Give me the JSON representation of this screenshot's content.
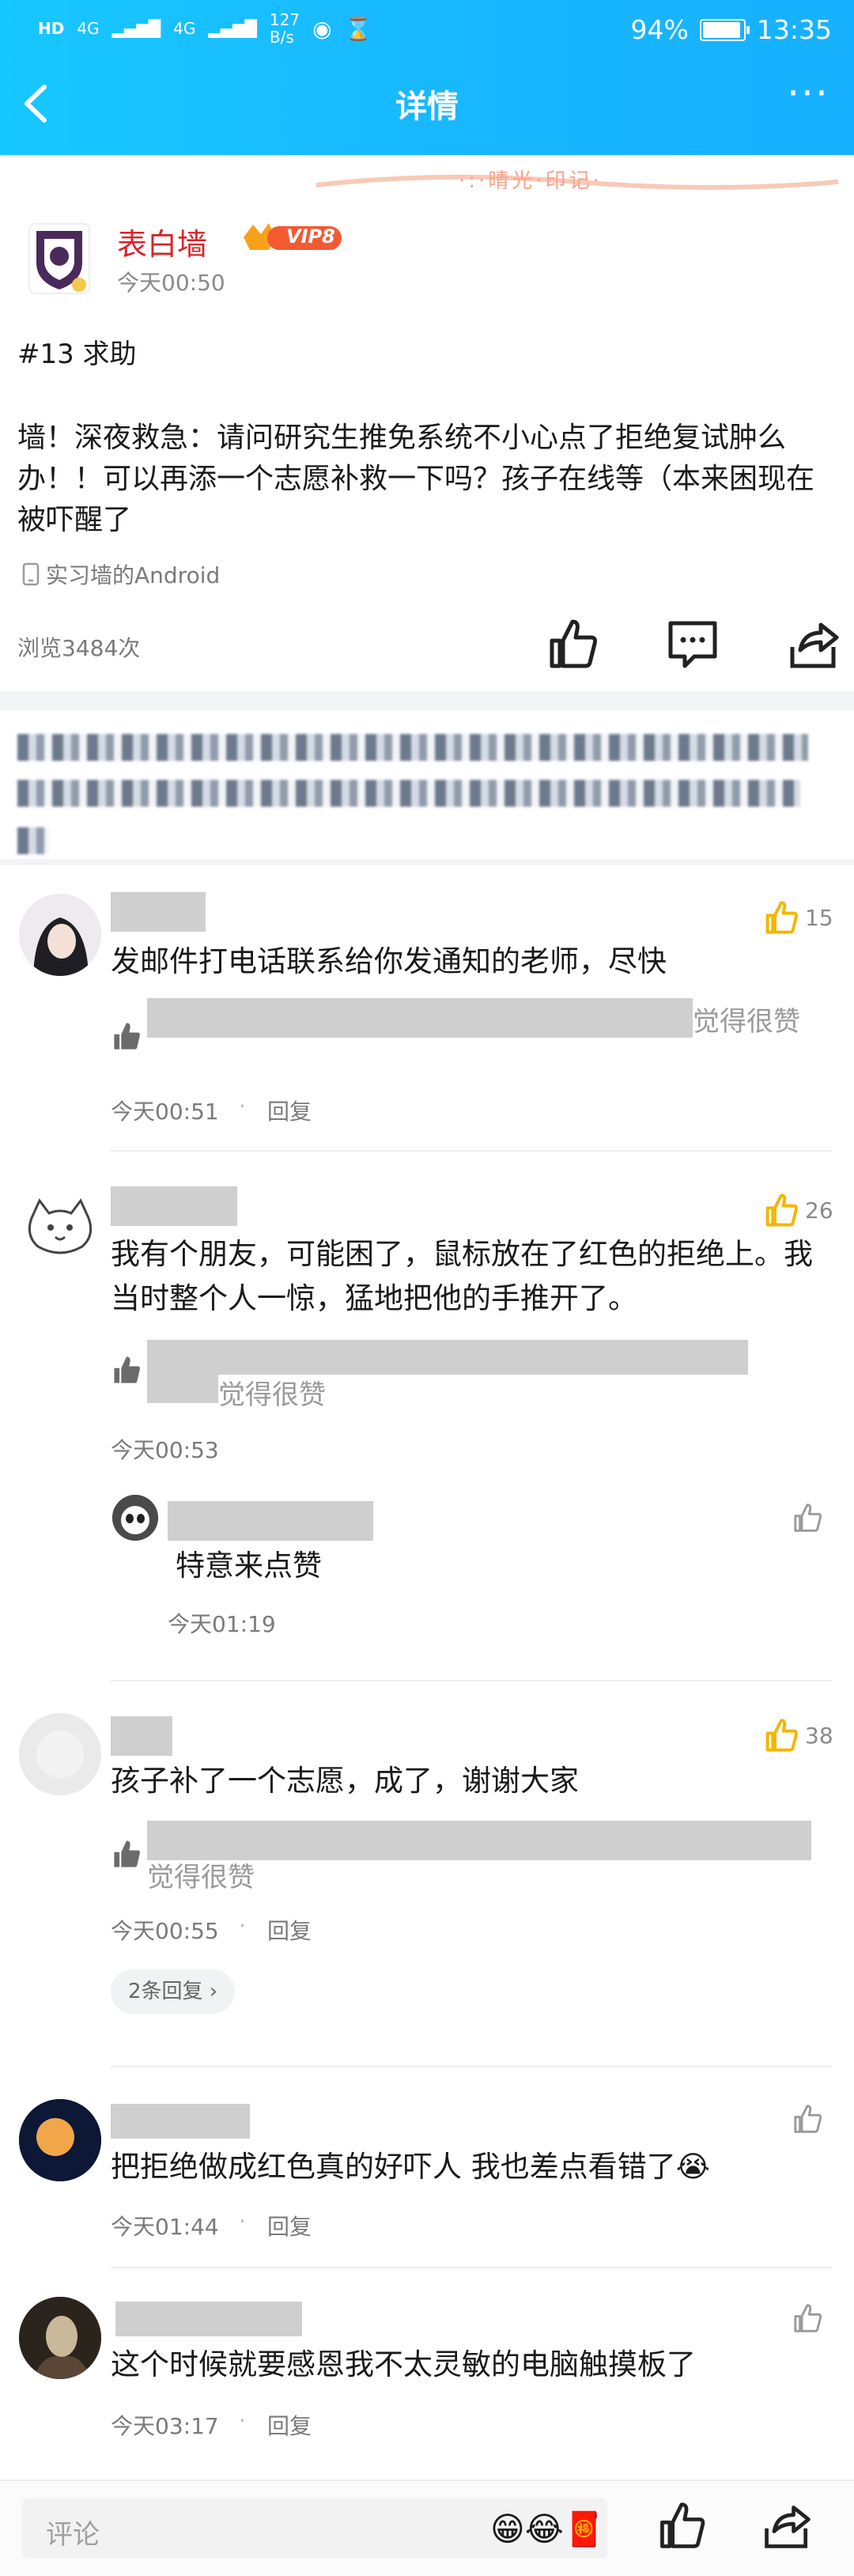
{
  "status_bar": {
    "left_top": "HD",
    "net1": "4G",
    "net2": "4G",
    "speed": "127",
    "speed_unit": "B/s",
    "battery": "94%",
    "battery_level": 0.94,
    "time": "13:35"
  },
  "nav": {
    "title": "详情",
    "more": "···"
  },
  "decor": {
    "text": "·:·晴光·印记·"
  },
  "post": {
    "author": "表白墙",
    "vip_label": "VIP8",
    "time": "今天00:50",
    "tag": "#13  求助",
    "body": "墙！深夜救急：请问研究生推免系统不小心点了拒绝复试肿么办！！可以再添一个志愿补救一下吗？孩子在线等（本来困现在被吓醒了",
    "device": "实习墙的Android",
    "views": "浏览3484次"
  },
  "comments": [
    {
      "text": "发邮件打电话联系给你发通知的老师，尽快",
      "liked": "觉得很赞",
      "time": "今天00:51",
      "reply": "回复",
      "likes": "15"
    },
    {
      "text": "我有个朋友，可能困了，鼠标放在了红色的拒绝上。我当时整个人一惊，猛地把他的手推开了。",
      "liked": "觉得很赞",
      "time": "今天00:53",
      "likes": "26"
    },
    {
      "text": "孩子补了一个志愿，成了，谢谢大家",
      "liked": "觉得很赞",
      "time": "今天00:55",
      "reply": "回复",
      "likes": "38",
      "replies": "2条回复 ›"
    },
    {
      "text": "把拒绝做成红色真的好吓人 我也差点看错了😭",
      "time": "今天01:44",
      "reply": "回复"
    },
    {
      "text": "这个时候就要感恩我不太灵敏的电脑触摸板了",
      "time": "今天03:17",
      "reply": "回复"
    }
  ],
  "sub_reply": {
    "text": "特意来点赞",
    "time": "今天01:19"
  },
  "bottom": {
    "placeholder": "评论",
    "emoji": "😁😂🧧"
  }
}
